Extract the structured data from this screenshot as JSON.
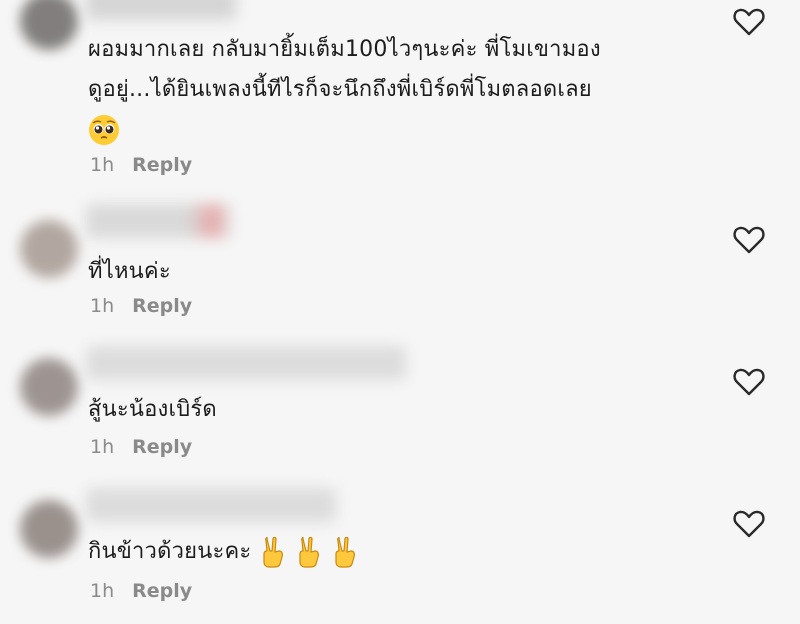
{
  "comments": [
    {
      "line1": "ผอมมากเลย กลับมายิ้มเต็ม100ไวๆนะค่ะ พี่โมเขามอง",
      "line2": "ดูอยู่...ได้ยินเพลงนี้ทีไรก็จะนึกถึงพี่เบิร์ดพี่โมตลอดเลย",
      "emoji": "pleading-face",
      "time": "1h",
      "reply": "Reply"
    },
    {
      "text": "ที่ไหนค่ะ",
      "time": "1h",
      "reply": "Reply"
    },
    {
      "text": "สู้นะน้องเบิร์ด",
      "time": "1h",
      "reply": "Reply"
    },
    {
      "text": "กินข้าวด้วยนะคะ",
      "emoji": "victory-hand",
      "emoji_count": 3,
      "time": "1h",
      "reply": "Reply"
    }
  ],
  "icons": {
    "like": "heart-outline-icon"
  },
  "colors": {
    "background": "#f6f6f6",
    "meta": "#8a8a8a",
    "text": "#1c1c1c"
  }
}
